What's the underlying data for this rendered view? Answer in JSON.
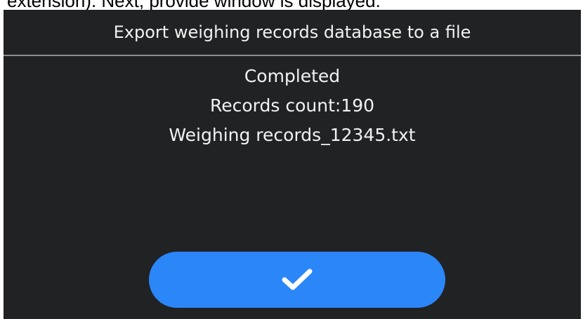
{
  "page_caption": "extension). Next, provide window is displayed:",
  "dialog": {
    "title": "Export weighing records database to a file",
    "status": "Completed",
    "records_count": "Records count:190",
    "file_name": "Weighing records_12345.txt",
    "confirm_icon": "checkmark-icon"
  },
  "colors": {
    "screen_background": "#202224",
    "text": "#f2f2f2",
    "divider": "#8d8f91",
    "button": "#2b86f8",
    "icon": "#ffffff"
  }
}
